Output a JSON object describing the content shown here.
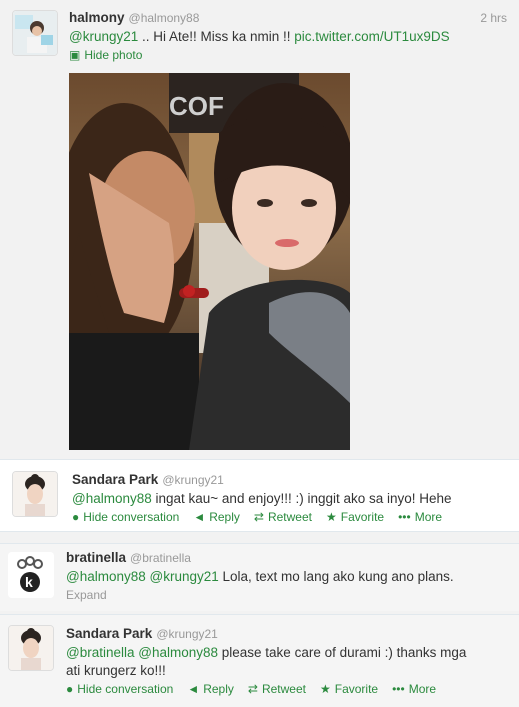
{
  "tweets": [
    {
      "name": "halmony",
      "handle": "@halmony88",
      "time": "2 hrs",
      "text_parts": [
        "@krungy21",
        " .. Hi Ate!! Miss ka nmin !! ",
        "pic.twitter.com/UT1ux9DS"
      ],
      "hide_photo": "Hide photo",
      "photo_sign": "COF"
    },
    {
      "name": "Sandara Park",
      "handle": "@krungy21",
      "text_parts": [
        "@halmony88",
        " ingat kau~ and enjoy!!! :) inggit ako sa inyo! Hehe"
      ],
      "actions": [
        "Hide conversation",
        "Reply",
        "Retweet",
        "Favorite",
        "More"
      ]
    },
    {
      "name": "bratinella",
      "handle": "@bratinella",
      "text_parts": [
        "@halmony88",
        " ",
        "@krungy21",
        " Lola, text mo lang ako kung ano plans."
      ],
      "expand": "Expand",
      "avatar_letter": "k"
    },
    {
      "name": "Sandara Park",
      "handle": "@krungy21",
      "text_parts": [
        "@bratinella",
        " ",
        "@halmony88",
        " please take care of durami :) thanks mga",
        "ati krungerz ko!!!"
      ],
      "actions": [
        "Hide conversation",
        "Reply",
        "Retweet",
        "Favorite",
        "More"
      ]
    }
  ],
  "colors": {
    "link": "#2b8a3e",
    "muted": "#999999",
    "bg": "#f2f2f2"
  }
}
